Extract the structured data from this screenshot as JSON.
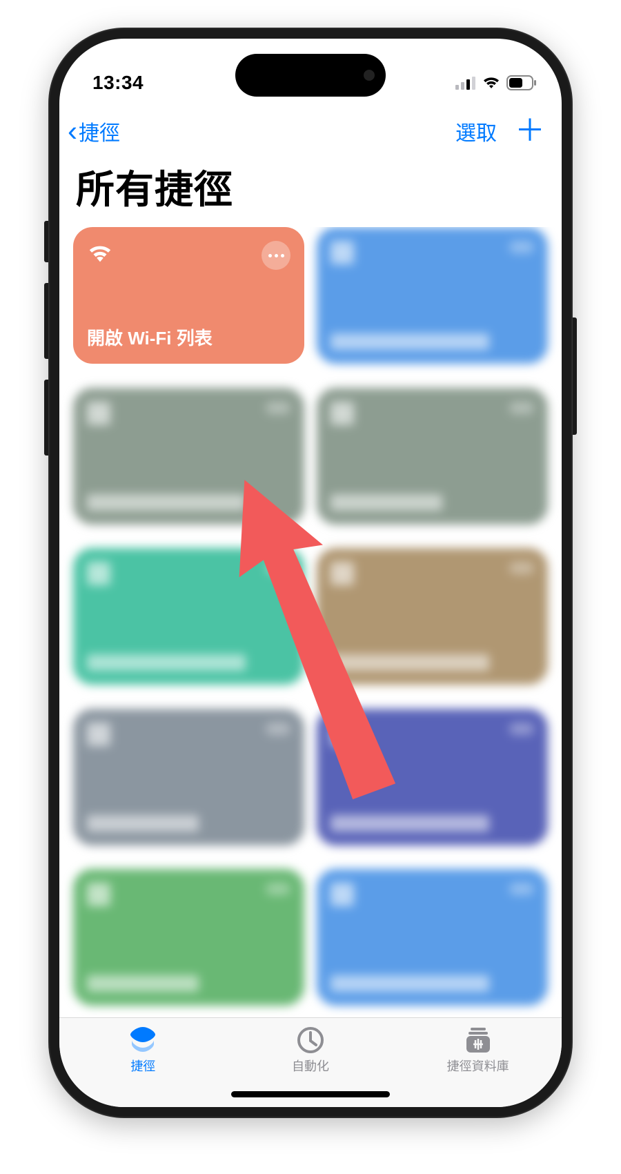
{
  "status": {
    "time": "13:34"
  },
  "nav": {
    "back": "捷徑",
    "select": "選取",
    "add": "＋"
  },
  "title": "所有捷徑",
  "shortcuts": [
    {
      "label": "開啟 Wi-Fi 列表",
      "color": "#f08a6e",
      "icon": "wifi-icon",
      "blurred": false
    },
    {
      "label": "",
      "color": "#5b9de8",
      "blurred": true
    },
    {
      "label": "",
      "color": "#8d9d91",
      "blurred": true
    },
    {
      "label": "",
      "color": "#8d9d91",
      "blurred": true
    },
    {
      "label": "",
      "color": "#4bc3a4",
      "blurred": true
    },
    {
      "label": "",
      "color": "#b09772",
      "blurred": true
    },
    {
      "label": "",
      "color": "#8b96a0",
      "blurred": true
    },
    {
      "label": "",
      "color": "#5963b8",
      "blurred": true
    },
    {
      "label": "",
      "color": "#69b874",
      "blurred": true
    },
    {
      "label": "",
      "color": "#5b9de8",
      "blurred": true
    }
  ],
  "tabs": {
    "shortcuts": "捷徑",
    "automation": "自動化",
    "gallery": "捷徑資料庫"
  }
}
